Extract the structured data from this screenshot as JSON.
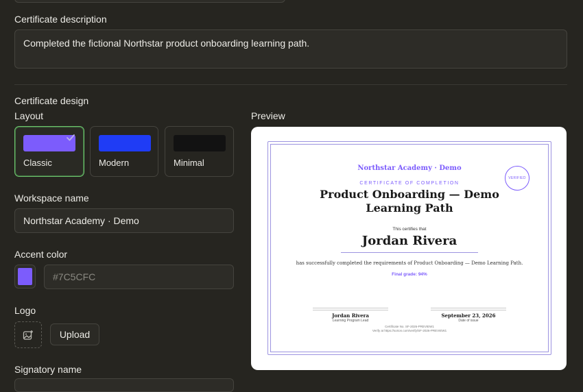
{
  "description": {
    "label": "Certificate description",
    "value": "Completed the fictional Northstar product onboarding learning path."
  },
  "design": {
    "section_label": "Certificate design",
    "layout_label": "Layout",
    "layouts": [
      {
        "name": "Classic",
        "color": "#7C5CFC",
        "selected": true
      },
      {
        "name": "Modern",
        "color": "#1F3CF5",
        "selected": false
      },
      {
        "name": "Minimal",
        "color": "#121212",
        "selected": false
      }
    ],
    "workspace_label": "Workspace name",
    "workspace_value": "Northstar Academy · Demo",
    "accent_label": "Accent color",
    "accent_value": "#7C5CFC",
    "accent_color": "#7C5CFC",
    "logo_label": "Logo",
    "upload_label": "Upload",
    "signatory_label": "Signatory name"
  },
  "preview": {
    "label": "Preview",
    "cert": {
      "org": "Northstar Academy · Demo",
      "seal": "VERIFIED",
      "kicker": "CERTIFICATE OF COMPLETION",
      "title_line1": "Product Onboarding — Demo",
      "title_line2": "Learning Path",
      "certifies": "This certifies that",
      "recipient": "Jordan Rivera",
      "completion": "has successfully completed the requirements of Product Onboarding — Demo Learning Path.",
      "grade": "Final grade: 94%",
      "signatory_name": "Jordan Rivera",
      "signatory_title": "Learning Program Lead",
      "date": "September 23, 2026",
      "date_label": "Date of issue",
      "cert_no": "Certificate No. SF-2026-PREVIEW1",
      "verify": "Verify at https://sorion.com/verify/SF-2026-PREVIEW1"
    }
  }
}
